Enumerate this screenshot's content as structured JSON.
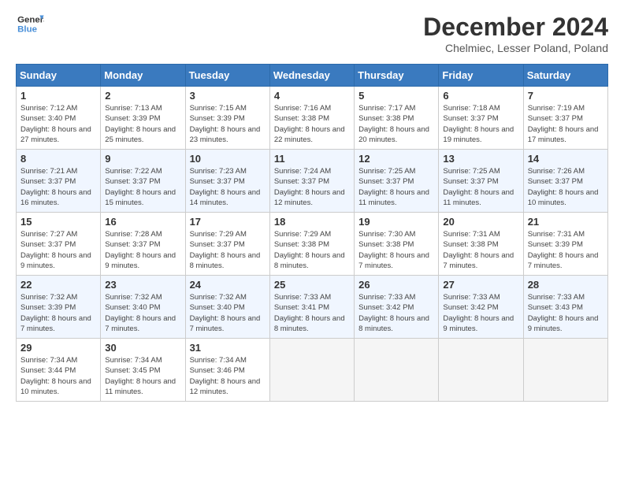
{
  "logo": {
    "line1": "General",
    "line2": "Blue"
  },
  "title": "December 2024",
  "subtitle": "Chelmiec, Lesser Poland, Poland",
  "headers": [
    "Sunday",
    "Monday",
    "Tuesday",
    "Wednesday",
    "Thursday",
    "Friday",
    "Saturday"
  ],
  "weeks": [
    [
      {
        "day": "1",
        "sunrise": "7:12 AM",
        "sunset": "3:40 PM",
        "daylight": "8 hours and 27 minutes."
      },
      {
        "day": "2",
        "sunrise": "7:13 AM",
        "sunset": "3:39 PM",
        "daylight": "8 hours and 25 minutes."
      },
      {
        "day": "3",
        "sunrise": "7:15 AM",
        "sunset": "3:39 PM",
        "daylight": "8 hours and 23 minutes."
      },
      {
        "day": "4",
        "sunrise": "7:16 AM",
        "sunset": "3:38 PM",
        "daylight": "8 hours and 22 minutes."
      },
      {
        "day": "5",
        "sunrise": "7:17 AM",
        "sunset": "3:38 PM",
        "daylight": "8 hours and 20 minutes."
      },
      {
        "day": "6",
        "sunrise": "7:18 AM",
        "sunset": "3:37 PM",
        "daylight": "8 hours and 19 minutes."
      },
      {
        "day": "7",
        "sunrise": "7:19 AM",
        "sunset": "3:37 PM",
        "daylight": "8 hours and 17 minutes."
      }
    ],
    [
      {
        "day": "8",
        "sunrise": "7:21 AM",
        "sunset": "3:37 PM",
        "daylight": "8 hours and 16 minutes."
      },
      {
        "day": "9",
        "sunrise": "7:22 AM",
        "sunset": "3:37 PM",
        "daylight": "8 hours and 15 minutes."
      },
      {
        "day": "10",
        "sunrise": "7:23 AM",
        "sunset": "3:37 PM",
        "daylight": "8 hours and 14 minutes."
      },
      {
        "day": "11",
        "sunrise": "7:24 AM",
        "sunset": "3:37 PM",
        "daylight": "8 hours and 12 minutes."
      },
      {
        "day": "12",
        "sunrise": "7:25 AM",
        "sunset": "3:37 PM",
        "daylight": "8 hours and 11 minutes."
      },
      {
        "day": "13",
        "sunrise": "7:25 AM",
        "sunset": "3:37 PM",
        "daylight": "8 hours and 11 minutes."
      },
      {
        "day": "14",
        "sunrise": "7:26 AM",
        "sunset": "3:37 PM",
        "daylight": "8 hours and 10 minutes."
      }
    ],
    [
      {
        "day": "15",
        "sunrise": "7:27 AM",
        "sunset": "3:37 PM",
        "daylight": "8 hours and 9 minutes."
      },
      {
        "day": "16",
        "sunrise": "7:28 AM",
        "sunset": "3:37 PM",
        "daylight": "8 hours and 9 minutes."
      },
      {
        "day": "17",
        "sunrise": "7:29 AM",
        "sunset": "3:37 PM",
        "daylight": "8 hours and 8 minutes."
      },
      {
        "day": "18",
        "sunrise": "7:29 AM",
        "sunset": "3:38 PM",
        "daylight": "8 hours and 8 minutes."
      },
      {
        "day": "19",
        "sunrise": "7:30 AM",
        "sunset": "3:38 PM",
        "daylight": "8 hours and 7 minutes."
      },
      {
        "day": "20",
        "sunrise": "7:31 AM",
        "sunset": "3:38 PM",
        "daylight": "8 hours and 7 minutes."
      },
      {
        "day": "21",
        "sunrise": "7:31 AM",
        "sunset": "3:39 PM",
        "daylight": "8 hours and 7 minutes."
      }
    ],
    [
      {
        "day": "22",
        "sunrise": "7:32 AM",
        "sunset": "3:39 PM",
        "daylight": "8 hours and 7 minutes."
      },
      {
        "day": "23",
        "sunrise": "7:32 AM",
        "sunset": "3:40 PM",
        "daylight": "8 hours and 7 minutes."
      },
      {
        "day": "24",
        "sunrise": "7:32 AM",
        "sunset": "3:40 PM",
        "daylight": "8 hours and 7 minutes."
      },
      {
        "day": "25",
        "sunrise": "7:33 AM",
        "sunset": "3:41 PM",
        "daylight": "8 hours and 8 minutes."
      },
      {
        "day": "26",
        "sunrise": "7:33 AM",
        "sunset": "3:42 PM",
        "daylight": "8 hours and 8 minutes."
      },
      {
        "day": "27",
        "sunrise": "7:33 AM",
        "sunset": "3:42 PM",
        "daylight": "8 hours and 9 minutes."
      },
      {
        "day": "28",
        "sunrise": "7:33 AM",
        "sunset": "3:43 PM",
        "daylight": "8 hours and 9 minutes."
      }
    ],
    [
      {
        "day": "29",
        "sunrise": "7:34 AM",
        "sunset": "3:44 PM",
        "daylight": "8 hours and 10 minutes."
      },
      {
        "day": "30",
        "sunrise": "7:34 AM",
        "sunset": "3:45 PM",
        "daylight": "8 hours and 11 minutes."
      },
      {
        "day": "31",
        "sunrise": "7:34 AM",
        "sunset": "3:46 PM",
        "daylight": "8 hours and 12 minutes."
      },
      null,
      null,
      null,
      null
    ]
  ]
}
